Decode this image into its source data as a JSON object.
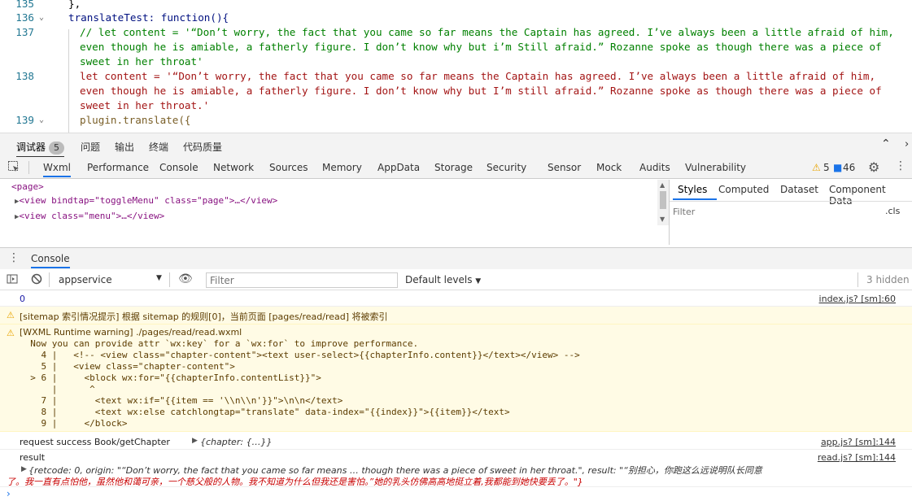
{
  "editor": {
    "lines": [
      {
        "num": "135",
        "text": "},"
      },
      {
        "num": "136",
        "text": "translateTest: function(){"
      },
      {
        "num": "137",
        "text": "// let content = '“Don’t worry, the fact that you came so far means the Captain has agreed. I’ve always been a little afraid of him,",
        "cont": [
          "even though he is amiable, a fatherly figure. I don’t know why but i’m Still afraid.” Rozanne spoke as though there was a piece of",
          "sweet in her throat'"
        ]
      },
      {
        "num": "138",
        "text": "let content = '“Don’t worry, the fact that you came so far means the Captain has agreed. I’ve always been a little afraid of him,",
        "cont": [
          "even though he is amiable, a fatherly figure. I don’t know why but I’m still afraid.” Rozanne spoke as though there was a piece of",
          "sweet in her throat.'"
        ]
      },
      {
        "num": "139",
        "text": "plugin.translate({"
      }
    ]
  },
  "panel_tabs": {
    "debugger": "调试器",
    "debugger_count": "5",
    "issues": "问题",
    "output": "输出",
    "terminal": "终端",
    "code_quality": "代码质量"
  },
  "devtools_tabs": [
    "Wxml",
    "Performance",
    "Console",
    "Network",
    "Sources",
    "Memory",
    "AppData",
    "Storage",
    "Security",
    "Sensor",
    "Mock",
    "Audits",
    "Vulnerability"
  ],
  "devtools_status": {
    "warnings": "5",
    "messages": "46"
  },
  "elements": [
    "<page>",
    "<view bindtap=\"toggleMenu\" class=\"page\">…</view>",
    "<view class=\"menu\">…</view>"
  ],
  "styles_tabs": [
    "Styles",
    "Computed",
    "Dataset",
    "Component Data"
  ],
  "styles_filter": {
    "placeholder": "Filter",
    "cls": ".cls"
  },
  "console": {
    "drawer_tab": "Console",
    "context": "appservice",
    "filter_placeholder": "Filter",
    "levels": "Default levels",
    "hidden": "3 hidden"
  },
  "messages": {
    "m0": {
      "text": "0",
      "src": "index.js? [sm]:60"
    },
    "m1": {
      "text": "[sitemap 索引情况提示] 根据 sitemap 的规则[0]，当前页面 [pages/read/read] 将被索引"
    },
    "m2": {
      "lines": [
        "[WXML Runtime warning] ./pages/read/read.wxml",
        "  Now you can provide attr `wx:key` for a `wx:for` to improve performance.",
        "    4 |   <!-- <view class=\"chapter-content\"><text user-select>{{chapterInfo.content}}</text></view> -->",
        "    5 |   <view class=\"chapter-content\">",
        "  > 6 |     <block wx:for=\"{{chapterInfo.contentList}}\">",
        "      |      ^",
        "    7 |       <text wx:if=\"{{item == '\\\\n\\\\n'}}\">\\n\\n</text>",
        "    8 |       <text wx:else catchlongtap=\"translate\" data-index=\"{{index}}\">{{item}}</text>",
        "    9 |     </block>"
      ]
    },
    "m3": {
      "text": "request success Book/getChapter",
      "obj": "{chapter: {…}}",
      "src": "app.js? [sm]:144"
    },
    "m4": {
      "text": "result",
      "src": "read.js? [sm]:144",
      "obj1": "{retcode: 0, origin: \"“Don’t worry, the fact that you came so far means … though there was a piece of sweet in her throat.\", result: \"“别担心，你跑这么远说明队长同意",
      "obj2": "了。我一直有点怕他，虽然他和蔼可亲，一个慈父般的人物。我不知道为什么但我还是害怕。”她的乳头仿佛高高地挺立着,我都能到她快要丢了。\"}"
    }
  }
}
